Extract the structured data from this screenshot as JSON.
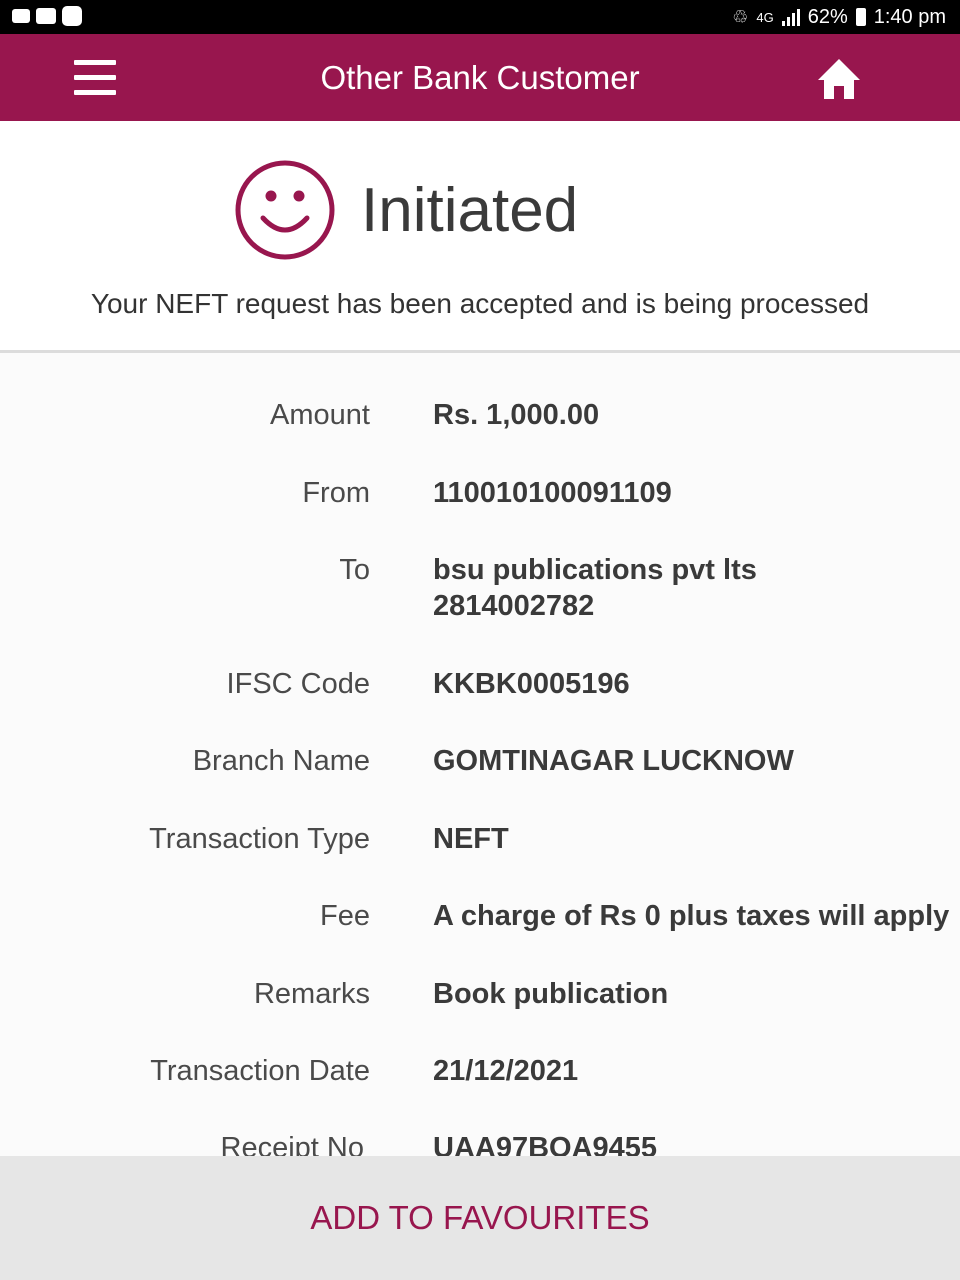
{
  "status_bar": {
    "battery": "62%",
    "time": "1:40 pm",
    "network": "4G"
  },
  "header": {
    "title": "Other Bank Customer",
    "menu_icon": "hamburger-menu-icon",
    "home_icon": "home-icon",
    "bg_color": "#98164e"
  },
  "status": {
    "title": "Initiated",
    "message": "Your NEFT request has been accepted and is being processed",
    "icon": "smiley-icon"
  },
  "details": [
    {
      "label": "Amount",
      "value": "Rs. 1,000.00"
    },
    {
      "label": "From",
      "value": "110010100091109"
    },
    {
      "label": "To",
      "value": "bsu publications pvt lts",
      "value2": "2814002782"
    },
    {
      "label": "IFSC Code",
      "value": "KKBK0005196"
    },
    {
      "label": "Branch Name",
      "value": "GOMTINAGAR LUCKNOW"
    },
    {
      "label": "Transaction Type",
      "value": "NEFT"
    },
    {
      "label": "Fee",
      "value": "A charge of Rs 0 plus taxes will apply"
    },
    {
      "label": "Remarks",
      "value": "Book publication"
    },
    {
      "label": "Transaction Date",
      "value": "21/12/2021"
    },
    {
      "label": "Receipt No",
      "value": "UAA97BQA9455"
    }
  ],
  "footer": {
    "button_label": "ADD TO FAVOURITES"
  }
}
